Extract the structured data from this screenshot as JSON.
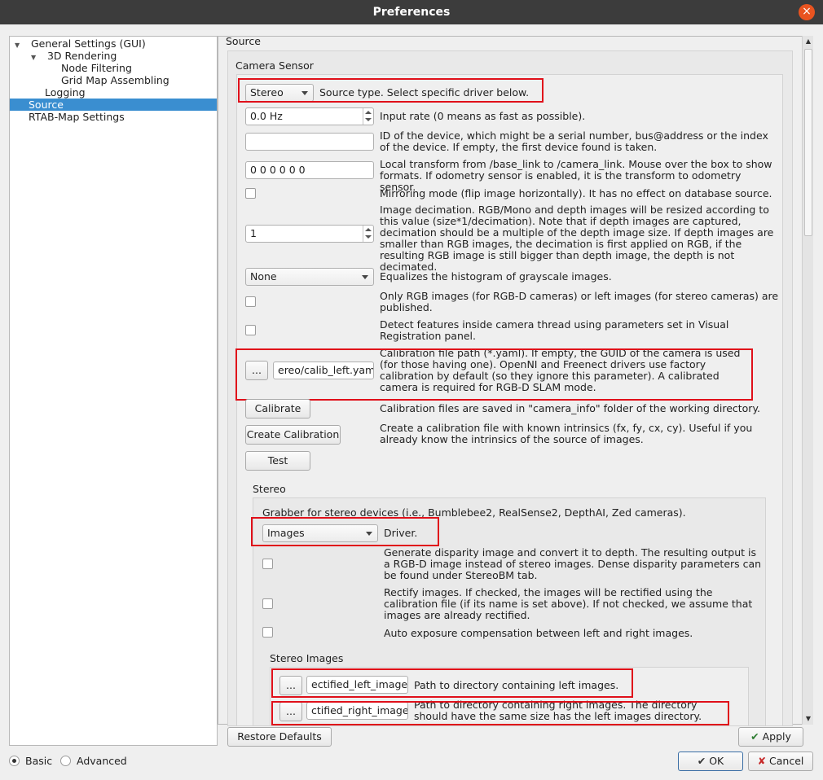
{
  "window": {
    "title": "Preferences",
    "close_glyph": "×"
  },
  "tree": [
    {
      "label": "General Settings (GUI)",
      "level": 0,
      "expanded": true
    },
    {
      "label": "3D Rendering",
      "level": 1,
      "expanded": true
    },
    {
      "label": "Node Filtering",
      "level": 2
    },
    {
      "label": "Grid Map Assembling",
      "level": 2
    },
    {
      "label": "Logging",
      "level": 1
    },
    {
      "label": "Source",
      "level": 0,
      "selected": true
    },
    {
      "label": "RTAB-Map Settings",
      "level": 0
    }
  ],
  "page": {
    "header": "Source"
  },
  "camera": {
    "group_title": "Camera Sensor",
    "source_type": {
      "value": "Stereo",
      "desc": "Source type. Select specific driver below."
    },
    "input_rate": {
      "value": "0.0 Hz",
      "desc": "Input rate (0 means as fast as possible)."
    },
    "device_id": {
      "value": "",
      "desc": "ID of the device, which might be a serial number, bus@address or the index of the device. If empty, the first device found is taken."
    },
    "local_transform": {
      "value": "0 0 0 0 0 0",
      "desc": "Local transform from /base_link to /camera_link. Mouse over the box to show formats. If odometry sensor is enabled, it is the transform to odometry sensor."
    },
    "mirroring": {
      "checked": false,
      "desc": "Mirroring mode (flip image horizontally). It has no effect on database source."
    },
    "decimation": {
      "value": "1",
      "desc": "Image decimation. RGB/Mono and depth images will be resized according to this value (size*1/decimation). Note that if depth images are captured, decimation should be a multiple of the depth image size. If depth images are smaller than RGB images, the decimation is first applied on RGB, if the resulting RGB image is still bigger than depth image, the depth is not decimated."
    },
    "histogram": {
      "value": "None",
      "desc": "Equalizes the histogram of grayscale images."
    },
    "rgb_only": {
      "checked": false,
      "desc": "Only RGB images (for RGB-D cameras) or left images (for stereo cameras) are published."
    },
    "detect_features": {
      "checked": false,
      "desc": "Detect features inside camera thread using parameters set in Visual Registration panel."
    },
    "calibration_path": {
      "browse_label": "...",
      "value": "ereo/calib_left.yaml",
      "desc": "Calibration file path (*.yaml). If empty, the GUID of the camera is used (for those having one). OpenNI and Freenect drivers use factory calibration by default (so they ignore this parameter). A calibrated camera is required for RGB-D SLAM mode."
    },
    "calibrate": {
      "label": "Calibrate",
      "desc": "Calibration files are saved in \"camera_info\" folder of the working directory."
    },
    "create_calibration": {
      "label": "Create Calibration",
      "desc": "Create a calibration file with known intrinsics (fx, fy, cx, cy). Useful if you already know the intrinsics of the source of images."
    },
    "test": {
      "label": "Test"
    }
  },
  "stereo": {
    "group_title": "Stereo",
    "intro": "Grabber for stereo devices (i.e., Bumblebee2, RealSense2, DepthAI,  Zed cameras).",
    "driver": {
      "value": "Images",
      "desc": "Driver."
    },
    "disparity": {
      "checked": false,
      "desc": "Generate disparity image and convert it to depth. The resulting output is a RGB-D image instead of stereo images. Dense disparity parameters can be found under StereoBM tab."
    },
    "rectify": {
      "checked": false,
      "desc": "Rectify images. If checked, the images will be rectified using the calibration file (if its name is set above). If not checked, we assume that images are already rectified."
    },
    "auto_exposure": {
      "checked": false,
      "desc": "Auto exposure compensation between left and right images."
    },
    "images": {
      "group_title": "Stereo Images",
      "left": {
        "browse_label": "...",
        "value": "ectified_left_images",
        "desc": "Path to directory containing left images."
      },
      "right": {
        "browse_label": "...",
        "value": "ctified_right_images",
        "desc": "Path to directory containing right images. The directory should have the same size has the left images directory."
      }
    }
  },
  "footer": {
    "restore_defaults": "Restore Defaults",
    "apply": "Apply",
    "ok": "OK",
    "cancel": "Cancel",
    "mode_basic": "Basic",
    "mode_advanced": "Advanced",
    "mode_selected": "Basic"
  },
  "colors": {
    "selection": "#3a8ed0",
    "highlight_box": "#e0101a",
    "close_button": "#e95420"
  }
}
